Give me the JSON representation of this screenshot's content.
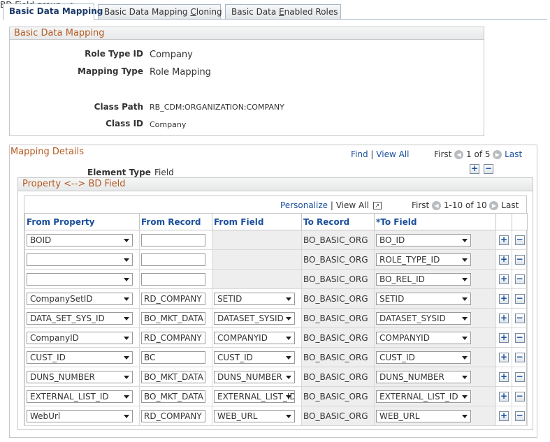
{
  "tabs": [
    {
      "label": "Basic Data Mapping",
      "active": true
    },
    {
      "label": "Basic Data Mapping Cloning",
      "pre": "Basic Data Mapping ",
      "ul": "C",
      "post": "loning"
    },
    {
      "label": "Basic Data Enabled Roles",
      "pre": "Basic Data ",
      "ul": "E",
      "post": "nabled Roles"
    }
  ],
  "basic": {
    "title": "Basic Data Mapping",
    "role_type_id_label": "Role Type ID",
    "role_type_id": "Company",
    "mapping_type_label": "Mapping Type",
    "mapping_type": "Role Mapping",
    "class_path_label": "Class Path",
    "class_path": "RB_CDM:ORGANIZATION:COMPANY",
    "class_id_label": "Class ID",
    "class_id": "Company"
  },
  "details": {
    "title": "Mapping Details",
    "find": "Find",
    "sep": "|",
    "view_all": "View All",
    "first": "First",
    "range": "1 of 5",
    "last": "Last",
    "element_type_label": "Element Type",
    "element_type": "Field"
  },
  "property": {
    "title": "Property <--> BD Field",
    "personalize": "Personalize",
    "view_all": "View All",
    "first": "First",
    "range": "1-10 of 10",
    "last": "Last",
    "columns": [
      "From Property",
      "From Record",
      "From Field",
      "To Record",
      "*To Field"
    ],
    "rows": [
      {
        "from_property": "BOID",
        "from_record": "",
        "from_field": null,
        "to_record": "BO_BASIC_ORG",
        "to_field": "BO_ID"
      },
      {
        "from_property": "",
        "from_record": "",
        "from_field": null,
        "to_record": "BO_BASIC_ORG",
        "to_field": "ROLE_TYPE_ID"
      },
      {
        "from_property": "",
        "from_record": "",
        "from_field": null,
        "to_record": "BO_BASIC_ORG",
        "to_field": "BO_REL_ID"
      },
      {
        "from_property": "CompanySetID",
        "from_record": "RD_COMPANY",
        "from_field": "SETID",
        "to_record": "BO_BASIC_ORG",
        "to_field": "SETID"
      },
      {
        "from_property": "DATA_SET_SYS_ID",
        "from_record": "BO_MKT_DATA",
        "from_field": "DATASET_SYSID",
        "to_record": "BO_BASIC_ORG",
        "to_field": "DATASET_SYSID"
      },
      {
        "from_property": "CompanyID",
        "from_record": "RD_COMPANY",
        "from_field": "COMPANYID",
        "to_record": "BO_BASIC_ORG",
        "to_field": "COMPANYID"
      },
      {
        "from_property": "CUST_ID",
        "from_record": "BC",
        "from_field": "CUST_ID",
        "to_record": "BO_BASIC_ORG",
        "to_field": "CUST_ID"
      },
      {
        "from_property": "DUNS_NUMBER",
        "from_record": "BO_MKT_DATA",
        "from_field": "DUNS_NUMBER",
        "to_record": "BO_BASIC_ORG",
        "to_field": "DUNS_NUMBER"
      },
      {
        "from_property": "EXTERNAL_LIST_ID",
        "from_record": "BO_MKT_DATA",
        "from_field": "EXTERNAL_LIST_ID",
        "to_record": "BO_BASIC_ORG",
        "to_field": "EXTERNAL_LIST_ID"
      },
      {
        "from_property": "WebUrl",
        "from_record": "RD_COMPANY",
        "from_field": "WEB_URL",
        "to_record": "BO_BASIC_ORG",
        "to_field": "WEB_URL"
      }
    ]
  },
  "colors": {
    "accent": "#1a4f9c",
    "section_title": "#b45a20",
    "border": "#c7c7c7"
  },
  "icons": {
    "add": "plus-icon",
    "remove": "minus-icon",
    "prev": "arrow-left-icon",
    "next": "arrow-right-icon",
    "popup": "popout-icon"
  }
}
